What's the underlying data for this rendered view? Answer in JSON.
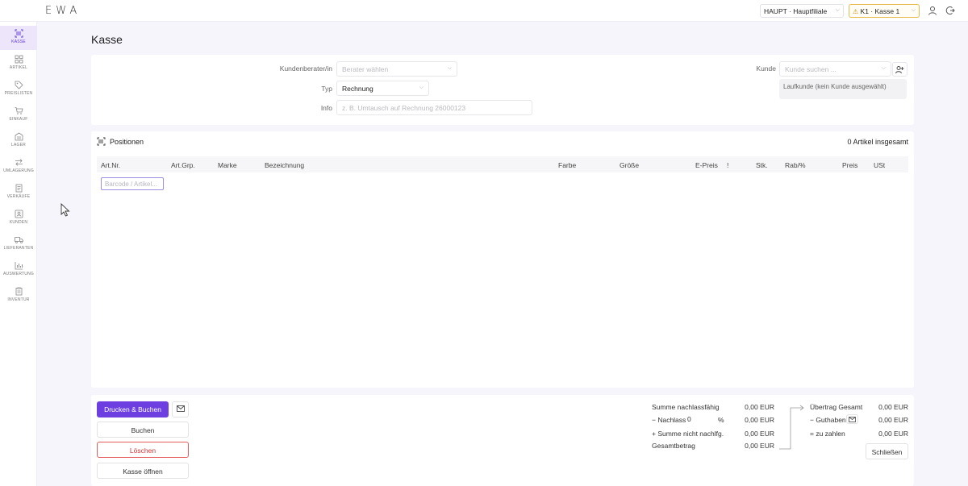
{
  "app": {
    "logo": "EWA"
  },
  "topbar": {
    "branch": "HAUPT · Hauptfiliale",
    "register": "K1 · Kasse 1"
  },
  "sidebar": {
    "items": [
      {
        "label": "KASSE",
        "icon": "register-icon",
        "active": true
      },
      {
        "label": "ARTIKEL",
        "icon": "grid-icon"
      },
      {
        "label": "PREISLISTEN",
        "icon": "tag-icon"
      },
      {
        "label": "EINKAUF",
        "icon": "cart-icon"
      },
      {
        "label": "LAGER",
        "icon": "warehouse-icon"
      },
      {
        "label": "UMLAGERUNG",
        "icon": "transfer-icon"
      },
      {
        "label": "VERKÄUFE",
        "icon": "document-icon"
      },
      {
        "label": "KUNDEN",
        "icon": "customer-icon"
      },
      {
        "label": "LIEFERANTEN",
        "icon": "truck-icon"
      },
      {
        "label": "AUSWERTUNG",
        "icon": "chart-icon"
      },
      {
        "label": "INVENTUR",
        "icon": "clipboard-icon"
      }
    ]
  },
  "page": {
    "title": "Kasse"
  },
  "header_form": {
    "advisor_label": "Kundenberater/in",
    "advisor_placeholder": "Berater wählen",
    "type_label": "Typ",
    "type_value": "Rechnung",
    "info_label": "Info",
    "info_placeholder": "z. B. Umtausch auf Rechnung 26000123",
    "customer_label": "Kunde",
    "customer_placeholder": "Kunde suchen ...",
    "walkin_text": "Laufkunde (kein Kunde ausgewählt)"
  },
  "positions": {
    "title": "Positionen",
    "count_text": "0 Artikel insgesamt",
    "columns": [
      "Art.Nr.",
      "Art.Grp.",
      "Marke",
      "Bezeichnung",
      "Farbe",
      "Größe",
      "E-Preis",
      "!",
      "Stk.",
      "Rab/%",
      "Preis",
      "USt"
    ],
    "barcode_placeholder": "Barcode / Artikel..."
  },
  "actions": {
    "print_book": "Drucken & Buchen",
    "book": "Buchen",
    "delete": "Löschen",
    "open_register": "Kasse öffnen",
    "close": "Schließen"
  },
  "totals": {
    "discountable_label": "Summe nachlassfähig",
    "discountable_value": "0,00 EUR",
    "discount_label": "− Nachlass",
    "discount_percent": "0",
    "percent_sign": "%",
    "discount_value": "0,00 EUR",
    "non_discountable_label": "+ Summe nicht nachlfg.",
    "non_discountable_value": "0,00 EUR",
    "total_label": "Gesamtbetrag",
    "total_value": "0,00 EUR",
    "carryover_label": "Übertrag Gesamt",
    "carryover_value": "0,00 EUR",
    "credit_label": "− Guthaben",
    "credit_value": "0,00 EUR",
    "to_pay_label": "= zu zahlen",
    "to_pay_value": "0,00 EUR"
  },
  "colors": {
    "accent": "#6d3fe0",
    "danger": "#e35a5a",
    "warning": "#e9b94a"
  }
}
